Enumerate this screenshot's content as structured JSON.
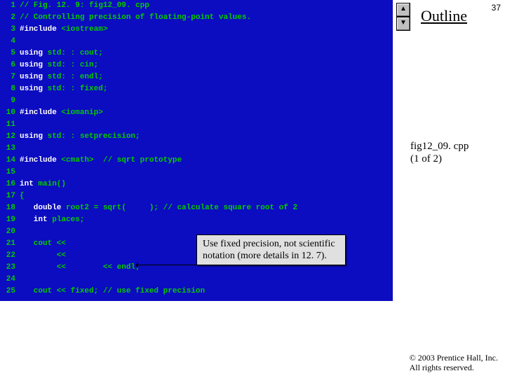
{
  "slide_number": "37",
  "outline_label": "Outline",
  "fig_label_line1": "fig12_09. cpp",
  "fig_label_line2": "(1 of 2)",
  "callout_text": "Use fixed precision, not scientific notation (more details in 12. 7).",
  "arrow_up": "▲",
  "arrow_down": "▼",
  "copyright_line1": "© 2003 Prentice Hall, Inc.",
  "copyright_line2": "All rights reserved.",
  "code": {
    "l1_a": "// Fig. 12. 9: fig12_09. cpp",
    "l2_a": "// Controlling precision of floating-point values.",
    "l3_a": "#include ",
    "l3_b": "<iostream>",
    "l5_a": "using ",
    "l5_b": "std: : cout;",
    "l6_a": "using ",
    "l6_b": "std: : cin;",
    "l7_a": "using ",
    "l7_b": "std: : endl;",
    "l8_a": "using ",
    "l8_b": "std: : fixed;",
    "l10_a": "#include ",
    "l10_b": "<iomanip>",
    "l12_a": "using ",
    "l12_b": "std: : setprecision;",
    "l14_a": "#include ",
    "l14_b": "<cmath>  ",
    "l14_c": "// sqrt prototype",
    "l16_a": "int ",
    "l16_b": "main()",
    "l17_a": "{",
    "l18_a": "   double ",
    "l18_b": "root2 = sqrt(     );",
    "l18_c": " // calculate square root of 2",
    "l19_a": "   int ",
    "l19_b": "places;",
    "l21_a": "   cout <<",
    "l22_a": "        <<",
    "l23_a": "        <<        << endl;",
    "l25_a": "   cout << fixed;",
    "l25_b": " // use fixed precision"
  },
  "line_numbers": [
    "1",
    "2",
    "3",
    "4",
    "5",
    "6",
    "7",
    "8",
    "9",
    "10",
    "11",
    "12",
    "13",
    "14",
    "15",
    "16",
    "17",
    "18",
    "19",
    "20",
    "21",
    "22",
    "23",
    "24",
    "25"
  ]
}
